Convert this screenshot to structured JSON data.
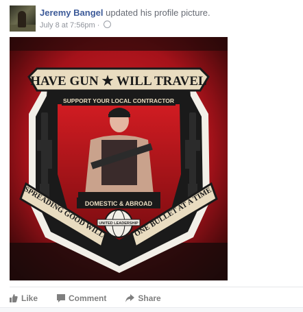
{
  "post": {
    "author": "Jeremy Bangel",
    "action": "updated his profile picture.",
    "timestamp": "July 8 at 7:56pm",
    "separator": "·",
    "privacy_icon": "globe-icon"
  },
  "image": {
    "banner_text": "HAVE GUN ★ WILL TRAVEL",
    "subtitle": "SUPPORT YOUR LOCAL CONTRACTOR",
    "center_text": "DOMESTIC & ABROAD",
    "left_scroll": "SPREADING GOOD WILL",
    "right_scroll": "ONE BULLET AT A TIME",
    "globe_text": "UNITED LEADERSHIP",
    "colors": {
      "red": "#b3131b",
      "dark": "#1a0a0a",
      "cream": "#e9dcc0"
    }
  },
  "actions": {
    "like": {
      "label": "Like",
      "icon": "thumbs-up-icon"
    },
    "comment": {
      "label": "Comment",
      "icon": "comment-icon"
    },
    "share": {
      "label": "Share",
      "icon": "share-arrow-icon"
    }
  }
}
